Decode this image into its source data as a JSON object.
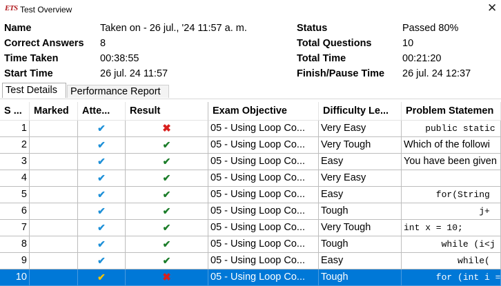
{
  "window": {
    "app_icon_text": "ETS",
    "title": "Test Overview",
    "close_glyph": "✕"
  },
  "summary": {
    "name_label": "Name",
    "name_value": "Taken on - 26 jul., '24 11:57 a. m.",
    "correct_label": "Correct Answers",
    "correct_value": "8",
    "time_taken_label": "Time Taken",
    "time_taken_value": "00:38:55",
    "start_label": "Start Time",
    "start_value": "26 jul. 24 11:57",
    "status_label": "Status",
    "status_value": "Passed 80%",
    "total_q_label": "Total Questions",
    "total_q_value": "10",
    "total_time_label": "Total Time",
    "total_time_value": "00:21:20",
    "finish_label": "Finish/Pause Time",
    "finish_value": "26 jul. 24 12:37"
  },
  "tabs": {
    "details": "Test Details",
    "performance": "Performance Report"
  },
  "table": {
    "headers": {
      "seq": "S ...",
      "marked": "Marked",
      "attempted": "Atte...",
      "result": "Result",
      "objective": "Exam Objective",
      "difficulty": "Difficulty Le...",
      "problem": "Problem Statemen"
    },
    "rows": [
      {
        "seq": "1",
        "attempted": "✔",
        "result": "✖",
        "result_kind": "fail",
        "objective": "05 - Using Loop Co...",
        "difficulty": "Very Easy",
        "problem": "    public static",
        "mono": true
      },
      {
        "seq": "2",
        "attempted": "✔",
        "result": "✔",
        "result_kind": "pass",
        "objective": "05 - Using Loop Co...",
        "difficulty": "Very Tough",
        "problem": "Which of the followi",
        "mono": false
      },
      {
        "seq": "3",
        "attempted": "✔",
        "result": "✔",
        "result_kind": "pass",
        "objective": "05 - Using Loop Co...",
        "difficulty": "Easy",
        "problem": "You have been given",
        "mono": false
      },
      {
        "seq": "4",
        "attempted": "✔",
        "result": "✔",
        "result_kind": "pass",
        "objective": "05 - Using Loop Co...",
        "difficulty": "Very Easy",
        "problem": "",
        "mono": false
      },
      {
        "seq": "5",
        "attempted": "✔",
        "result": "✔",
        "result_kind": "pass",
        "objective": "05 - Using Loop Co...",
        "difficulty": "Easy",
        "problem": "      for(String",
        "mono": true
      },
      {
        "seq": "6",
        "attempted": "✔",
        "result": "✔",
        "result_kind": "pass",
        "objective": "05 - Using Loop Co...",
        "difficulty": "Tough",
        "problem": "              j+",
        "mono": true
      },
      {
        "seq": "7",
        "attempted": "✔",
        "result": "✔",
        "result_kind": "pass",
        "objective": "05 - Using Loop Co...",
        "difficulty": "Very Tough",
        "problem": "int x = 10;",
        "mono": true
      },
      {
        "seq": "8",
        "attempted": "✔",
        "result": "✔",
        "result_kind": "pass",
        "objective": "05 - Using Loop Co...",
        "difficulty": "Tough",
        "problem": "       while (i<j",
        "mono": true
      },
      {
        "seq": "9",
        "attempted": "✔",
        "result": "✔",
        "result_kind": "pass",
        "objective": "05 - Using Loop Co...",
        "difficulty": "Easy",
        "problem": "          while(",
        "mono": true
      },
      {
        "seq": "10",
        "attempted": "✔",
        "result": "✖",
        "result_kind": "fail",
        "objective": "05 - Using Loop Co...",
        "difficulty": "Tough",
        "problem": "      for (int i =",
        "mono": true,
        "selected": true
      }
    ]
  },
  "colors": {
    "selection": "#0078d7",
    "check_blue": "#1e90d8",
    "pass_green": "#1c7d2a",
    "fail_red": "#d8201e",
    "selected_check": "#f4c400"
  }
}
